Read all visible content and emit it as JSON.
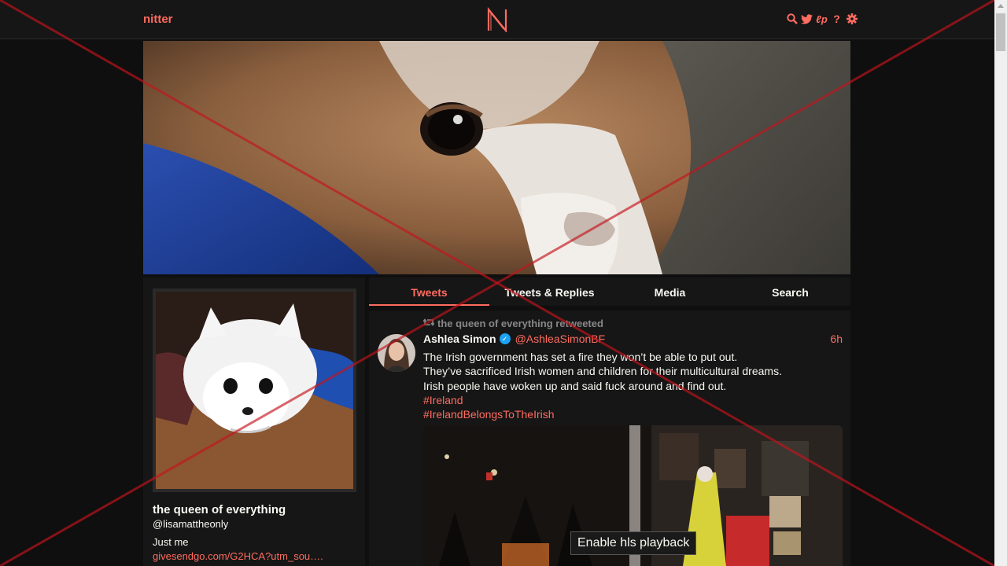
{
  "nav": {
    "brand": "nitter",
    "logo_letter": "N",
    "icons": [
      "search-icon",
      "twitter-bird-icon",
      "rss-icon",
      "help-icon",
      "gear-icon"
    ]
  },
  "profile": {
    "name": "the queen of everything",
    "handle": "@lisamattheonly",
    "bio": "Just me",
    "link": "givesendgo.com/G2HCA?utm_sou…."
  },
  "tabs": [
    {
      "label": "Tweets",
      "active": true
    },
    {
      "label": "Tweets & Replies",
      "active": false
    },
    {
      "label": "Media",
      "active": false
    },
    {
      "label": "Search",
      "active": false
    }
  ],
  "tweet": {
    "retweet_label": "the queen of everything retweeted",
    "fullname": "Ashlea Simon",
    "username": "@AshleaSimonBF",
    "date": "6h",
    "lines": [
      "The Irish government has set a fire they won’t be able to put out.",
      "They’ve sacrificed Irish women and children for their multicultural dreams.",
      "Irish people have woken up and said fuck around and find out."
    ],
    "hashtags": [
      "#Ireland",
      "#IrelandBelongsToTheIrish"
    ],
    "playback_label": "Enable hls playback"
  },
  "colors": {
    "accent": "#ff6c60",
    "background": "#0f0f0f",
    "panel": "#161616",
    "verified": "#1da1f2"
  }
}
